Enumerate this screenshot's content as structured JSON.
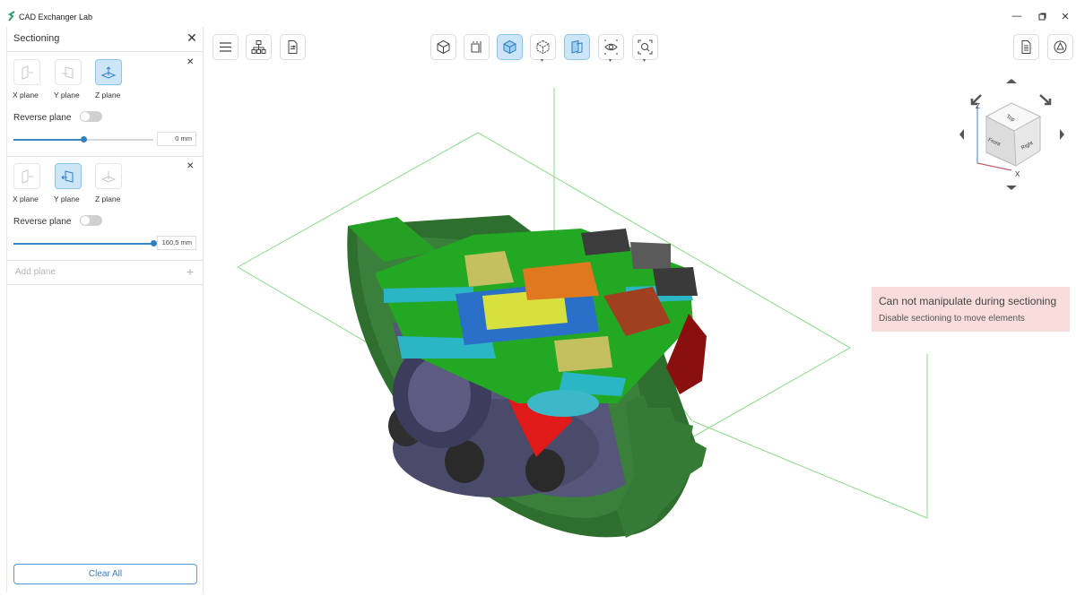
{
  "app": {
    "title": "CAD Exchanger Lab"
  },
  "panel": {
    "title": "Sectioning",
    "planes": [
      {
        "active_axis": "Z",
        "labels": [
          "X plane",
          "Y plane",
          "Z plane"
        ],
        "reverse_label": "Reverse plane",
        "reverse_on": false,
        "value": "0 mm",
        "slider_fraction": 0.5
      },
      {
        "active_axis": "Y",
        "labels": [
          "X plane",
          "Y plane",
          "Z plane"
        ],
        "reverse_label": "Reverse plane",
        "reverse_on": false,
        "value": "160,5 mm",
        "slider_fraction": 1.0
      }
    ],
    "add_plane": "Add plane",
    "clear_all": "Clear All"
  },
  "toolbar": {
    "left": [
      "menu-icon",
      "structure-icon",
      "file-icon"
    ],
    "center": [
      "view-shaded-icon",
      "view-section-icon",
      "view-solid-icon",
      "view-wire-icon",
      "section-box-icon",
      "visibility-icon",
      "zoom-fit-icon"
    ],
    "right": [
      "properties-icon",
      "settings-icon"
    ]
  },
  "viewcube": {
    "faces": [
      "Top",
      "Front",
      "Right"
    ],
    "axes": [
      "Z",
      "X"
    ]
  },
  "toast": {
    "title": "Can not manipulate during sectioning",
    "subtitle": "Disable sectioning to move elements"
  },
  "colors": {
    "accent": "#3a88c6",
    "active_bg": "#cde6f7",
    "section_green": "#1c9e1c",
    "toast_bg": "#f9dcdc"
  }
}
